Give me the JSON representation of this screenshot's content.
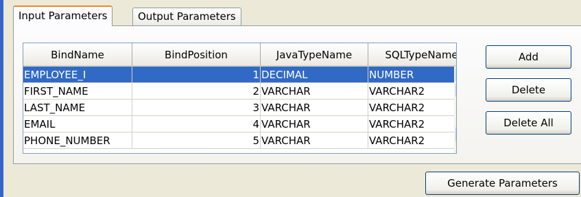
{
  "tabs": {
    "input_label": "Input Parameters",
    "output_label": "Output Parameters"
  },
  "table": {
    "columns": [
      "BindName",
      "BindPosition",
      "JavaTypeName",
      "SQLTypeName"
    ],
    "rows": [
      {
        "bind_name": "EMPLOYEE_I",
        "bind_position": "1",
        "java_type": "DECIMAL",
        "sql_type": "NUMBER",
        "selected": true
      },
      {
        "bind_name": "FIRST_NAME",
        "bind_position": "2",
        "java_type": "VARCHAR",
        "sql_type": "VARCHAR2"
      },
      {
        "bind_name": "LAST_NAME",
        "bind_position": "3",
        "java_type": "VARCHAR",
        "sql_type": "VARCHAR2"
      },
      {
        "bind_name": "EMAIL",
        "bind_position": "4",
        "java_type": "VARCHAR",
        "sql_type": "VARCHAR2"
      },
      {
        "bind_name": "PHONE_NUMBER",
        "bind_position": "5",
        "java_type": "VARCHAR",
        "sql_type": "VARCHAR2"
      }
    ]
  },
  "buttons": {
    "add": "Add",
    "delete": "Delete",
    "delete_all": "Delete All",
    "generate": "Generate Parameters"
  },
  "icons": {
    "scroll_up": "chevron-up-icon",
    "scroll_down": "chevron-down-icon"
  },
  "colors": {
    "selection": "#316AC5",
    "active_tab_accent": "#E68B2C",
    "window_background": "#ECE9D8"
  }
}
